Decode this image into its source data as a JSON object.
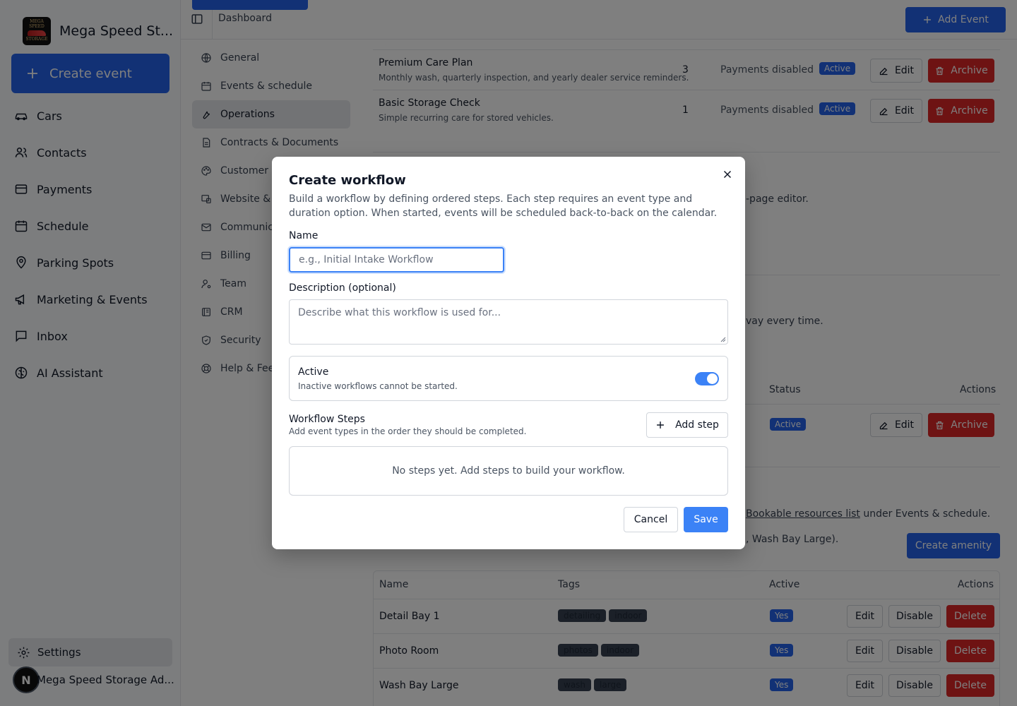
{
  "app": {
    "brand_name": "Mega Speed St...",
    "logo_text_top": "MEGA SPEED",
    "logo_text_bottom": "STORAGE",
    "create_event_label": "Create event",
    "nav": [
      {
        "label": "Cars",
        "icon": "car-icon"
      },
      {
        "label": "Contacts",
        "icon": "users-icon"
      },
      {
        "label": "Payments",
        "icon": "credit-card-icon"
      },
      {
        "label": "Schedule",
        "icon": "calendar-icon"
      },
      {
        "label": "Parking Spots",
        "icon": "map-pin-icon"
      },
      {
        "label": "Marketing & Events",
        "icon": "megaphone-icon"
      },
      {
        "label": "Inbox",
        "icon": "message-square-icon"
      },
      {
        "label": "AI Assistant",
        "icon": "brain-icon"
      }
    ],
    "settings_label": "Settings",
    "user_initial": "N",
    "user_name": "Mega Speed Storage Ad..."
  },
  "topbar": {
    "breadcrumb": "Dashboard",
    "add_event_label": "Add Event"
  },
  "settings_nav": [
    {
      "label": "General",
      "icon": "globe-icon"
    },
    {
      "label": "Events & schedule",
      "icon": "calendar-icon"
    },
    {
      "label": "Operations",
      "icon": "wrench-icon"
    },
    {
      "label": "Contracts & Documents",
      "icon": "file-icon"
    },
    {
      "label": "Customer p",
      "icon": "palette-icon"
    },
    {
      "label": "Website & s",
      "icon": "website-icon"
    },
    {
      "label": "Communic",
      "icon": "mail-icon"
    },
    {
      "label": "Billing",
      "icon": "credit-card-icon"
    },
    {
      "label": "Team",
      "icon": "user-cog-icon"
    },
    {
      "label": "CRM",
      "icon": "crm-icon"
    },
    {
      "label": "Security",
      "icon": "shield-icon"
    },
    {
      "label": "Help & Fee",
      "icon": "lifebuoy-icon"
    }
  ],
  "plans": [
    {
      "title": "Premium Care Plan",
      "description": "Monthly wash, quarterly inspection, and yearly dealer service reminders.",
      "count": "3",
      "payments": "Payments disabled",
      "status": "Active",
      "edit": "Edit",
      "archive": "Archive"
    },
    {
      "title": "Basic Storage Check",
      "description": "Simple recurring care for stored vehicles.",
      "count": "1",
      "payments": "Payments disabled",
      "status": "Active",
      "edit": "Edit",
      "archive": "Archive"
    }
  ],
  "background": {
    "page_editor_text": "-page editor.",
    "every_time_text": "vay every time.",
    "status_header": "Status",
    "actions_header": "Actions",
    "workflow_row_status": "Active",
    "workflow_row_edit": "Edit",
    "workflow_row_archive": "Archive",
    "bookable_link": "Bookable resources list",
    "bookable_suffix": " under Events & schedule.",
    "wash_bay_text": ", Wash Bay Large).",
    "create_amenity_label": "Create amenity"
  },
  "amenities": {
    "headers": {
      "name": "Name",
      "tags": "Tags",
      "active": "Active",
      "actions": "Actions"
    },
    "rows": [
      {
        "name": "Detail Bay 1",
        "tags": [
          "detailing",
          "indoor"
        ],
        "active": "Yes",
        "edit": "Edit",
        "disable": "Disable",
        "delete": "Delete"
      },
      {
        "name": "Photo Room",
        "tags": [
          "photos",
          "indoor"
        ],
        "active": "Yes",
        "edit": "Edit",
        "disable": "Disable",
        "delete": "Delete"
      },
      {
        "name": "Wash Bay Large",
        "tags": [
          "wash",
          "large"
        ],
        "active": "Yes",
        "edit": "Edit",
        "disable": "Disable",
        "delete": "Delete"
      }
    ]
  },
  "modal": {
    "title": "Create workflow",
    "description": "Build a workflow by defining ordered steps. Each step requires an event type and duration option. When started, events will be scheduled back-to-back on the calendar.",
    "name_label": "Name",
    "name_placeholder": "e.g., Initial Intake Workflow",
    "description_label": "Description (optional)",
    "description_placeholder": "Describe what this workflow is used for...",
    "active_label": "Active",
    "active_help": "Inactive workflows cannot be started.",
    "active_on": true,
    "steps_label": "Workflow Steps",
    "steps_help": "Add event types in the order they should be completed.",
    "add_step_label": "Add step",
    "empty_steps": "No steps yet. Add steps to build your workflow.",
    "cancel_label": "Cancel",
    "save_label": "Save"
  },
  "colors": {
    "primary": "#2563eb",
    "danger": "#dc2626",
    "overlay": "rgba(0,0,0,0.5)"
  }
}
